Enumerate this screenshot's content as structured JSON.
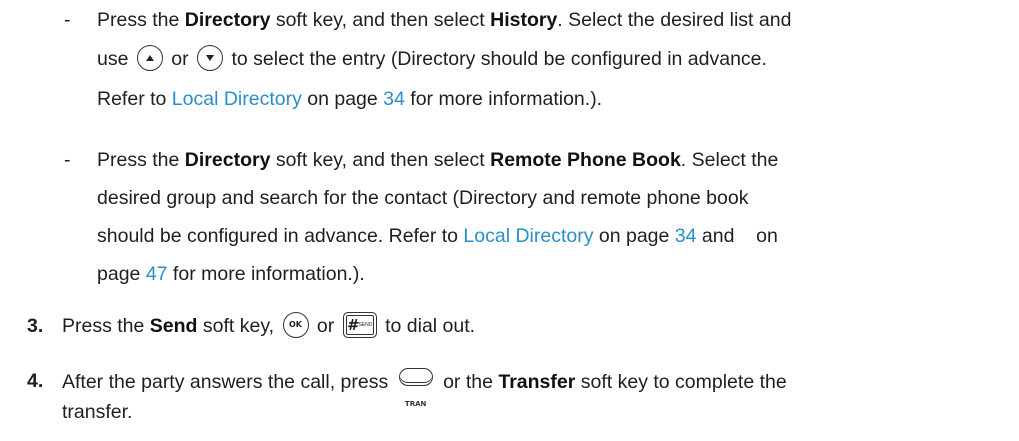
{
  "history_item": {
    "dash": "-",
    "l1_a": "Press the ",
    "l1_b": "Directory",
    "l1_c": " soft key, and then select ",
    "l1_d": "History",
    "l1_e": ". Select the desired list and",
    "l2_a": "use",
    "l2_b": "or",
    "l2_c": "to select the entry (Directory should be configured in advance.",
    "l3_a": "Refer to ",
    "l3_link": "Local Directory",
    "l3_b": " on page ",
    "l3_page": "34",
    "l3_c": " for more information.)."
  },
  "remote_item": {
    "dash": "-",
    "l1_a": "Press the ",
    "l1_b": "Directory",
    "l1_c": " soft key, and then select ",
    "l1_d": "Remote Phone Book",
    "l1_e": ". Select the",
    "l2": "desired group and search for the contact (Directory and remote phone book",
    "l3_a": "should be configured in advance. Refer to ",
    "l3_link": "Local Directory",
    "l3_b": " on page ",
    "l3_page": "34",
    "l3_c": " and    on",
    "l4_a": "page ",
    "l4_page": "47",
    "l4_b": " for more information.)."
  },
  "step3": {
    "num": "3.",
    "a": "Press the ",
    "b": "Send",
    "c": " soft key,",
    "d": "or",
    "e": "to dial out."
  },
  "step4": {
    "num": "4.",
    "a": "After the party answers the call, press",
    "b": "or the ",
    "c": "Transfer",
    "d": " soft key to complete the",
    "e": "transfer."
  },
  "icons": {
    "up_symbol": "▲",
    "down_symbol": "▼",
    "ok_label": "OK",
    "pound_symbol": "#",
    "pound_sub": "SEND",
    "tran_label": "TRAN"
  },
  "colors": {
    "link": "#2a8fc6",
    "text": "#1f1f1f"
  }
}
